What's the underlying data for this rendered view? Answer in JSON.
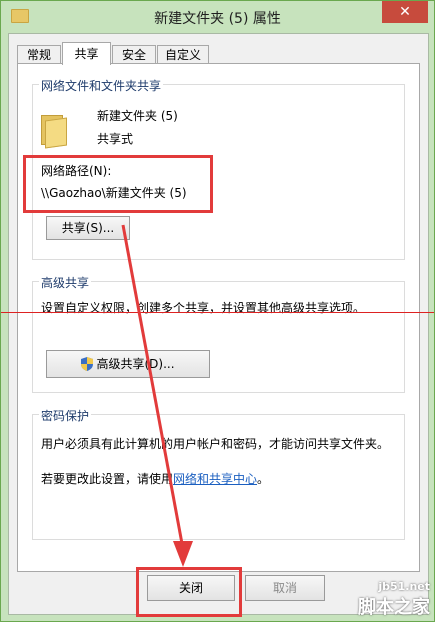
{
  "window": {
    "title": "新建文件夹 (5) 属性",
    "close_glyph": "✕"
  },
  "tabs": [
    "常规",
    "共享",
    "安全",
    "自定义"
  ],
  "network_share": {
    "group_label": "网络文件和文件夹共享",
    "folder_name": "新建文件夹 (5)",
    "status": "共享式",
    "path_label": "网络路径(N):",
    "path_value": "\\\\Gaozhao\\新建文件夹 (5)",
    "share_button": "共享(S)..."
  },
  "advanced_share": {
    "group_label": "高级共享",
    "description": "设置自定义权限，创建多个共享，并设置其他高级共享选项。",
    "button": "高级共享(D)..."
  },
  "password_protection": {
    "group_label": "密码保护",
    "description": "用户必须具有此计算机的用户帐户和密码，才能访问共享文件夹。",
    "change_prefix": "若要更改此设置，请使用",
    "link": "网络和共享中心",
    "change_suffix": "。"
  },
  "footer": {
    "close": "关闭",
    "cancel": "取消"
  },
  "watermark": {
    "site": "jb51.net",
    "brand": "脚本之家"
  },
  "colors": {
    "annotation_red": "#e23b3b",
    "link_blue": "#1b5fc0",
    "title_green": "#c7e3bd"
  }
}
